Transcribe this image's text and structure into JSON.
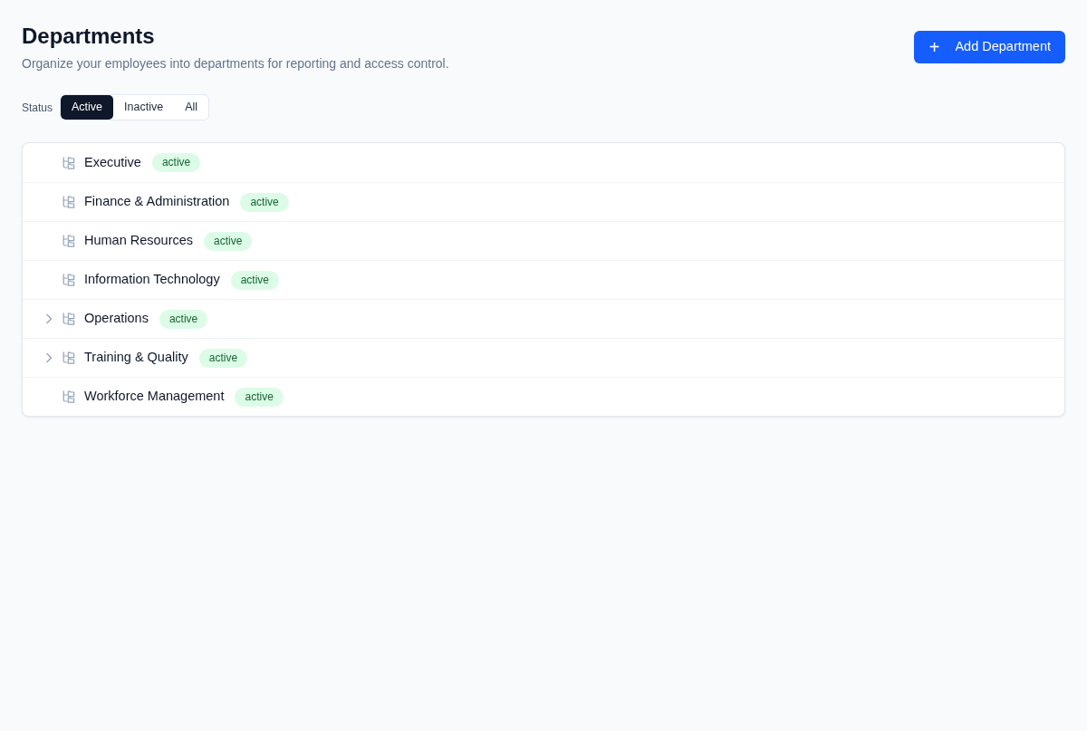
{
  "header": {
    "title": "Departments",
    "subtitle": "Organize your employees into departments for reporting and access control.",
    "add_button": {
      "label": "Add Department",
      "icon": "+"
    }
  },
  "status_filter": {
    "label": "Status",
    "options": [
      {
        "label": "Active",
        "selected": true
      },
      {
        "label": "Inactive",
        "selected": false
      },
      {
        "label": "All",
        "selected": false
      }
    ]
  },
  "departments": [
    {
      "name": "Executive",
      "status": "active",
      "expandable": false
    },
    {
      "name": "Finance & Administration",
      "status": "active",
      "expandable": false
    },
    {
      "name": "Human Resources",
      "status": "active",
      "expandable": false
    },
    {
      "name": "Information Technology",
      "status": "active",
      "expandable": false
    },
    {
      "name": "Operations",
      "status": "active",
      "expandable": true
    },
    {
      "name": "Training & Quality",
      "status": "active",
      "expandable": true
    },
    {
      "name": "Workforce Management",
      "status": "active",
      "expandable": false
    }
  ]
}
